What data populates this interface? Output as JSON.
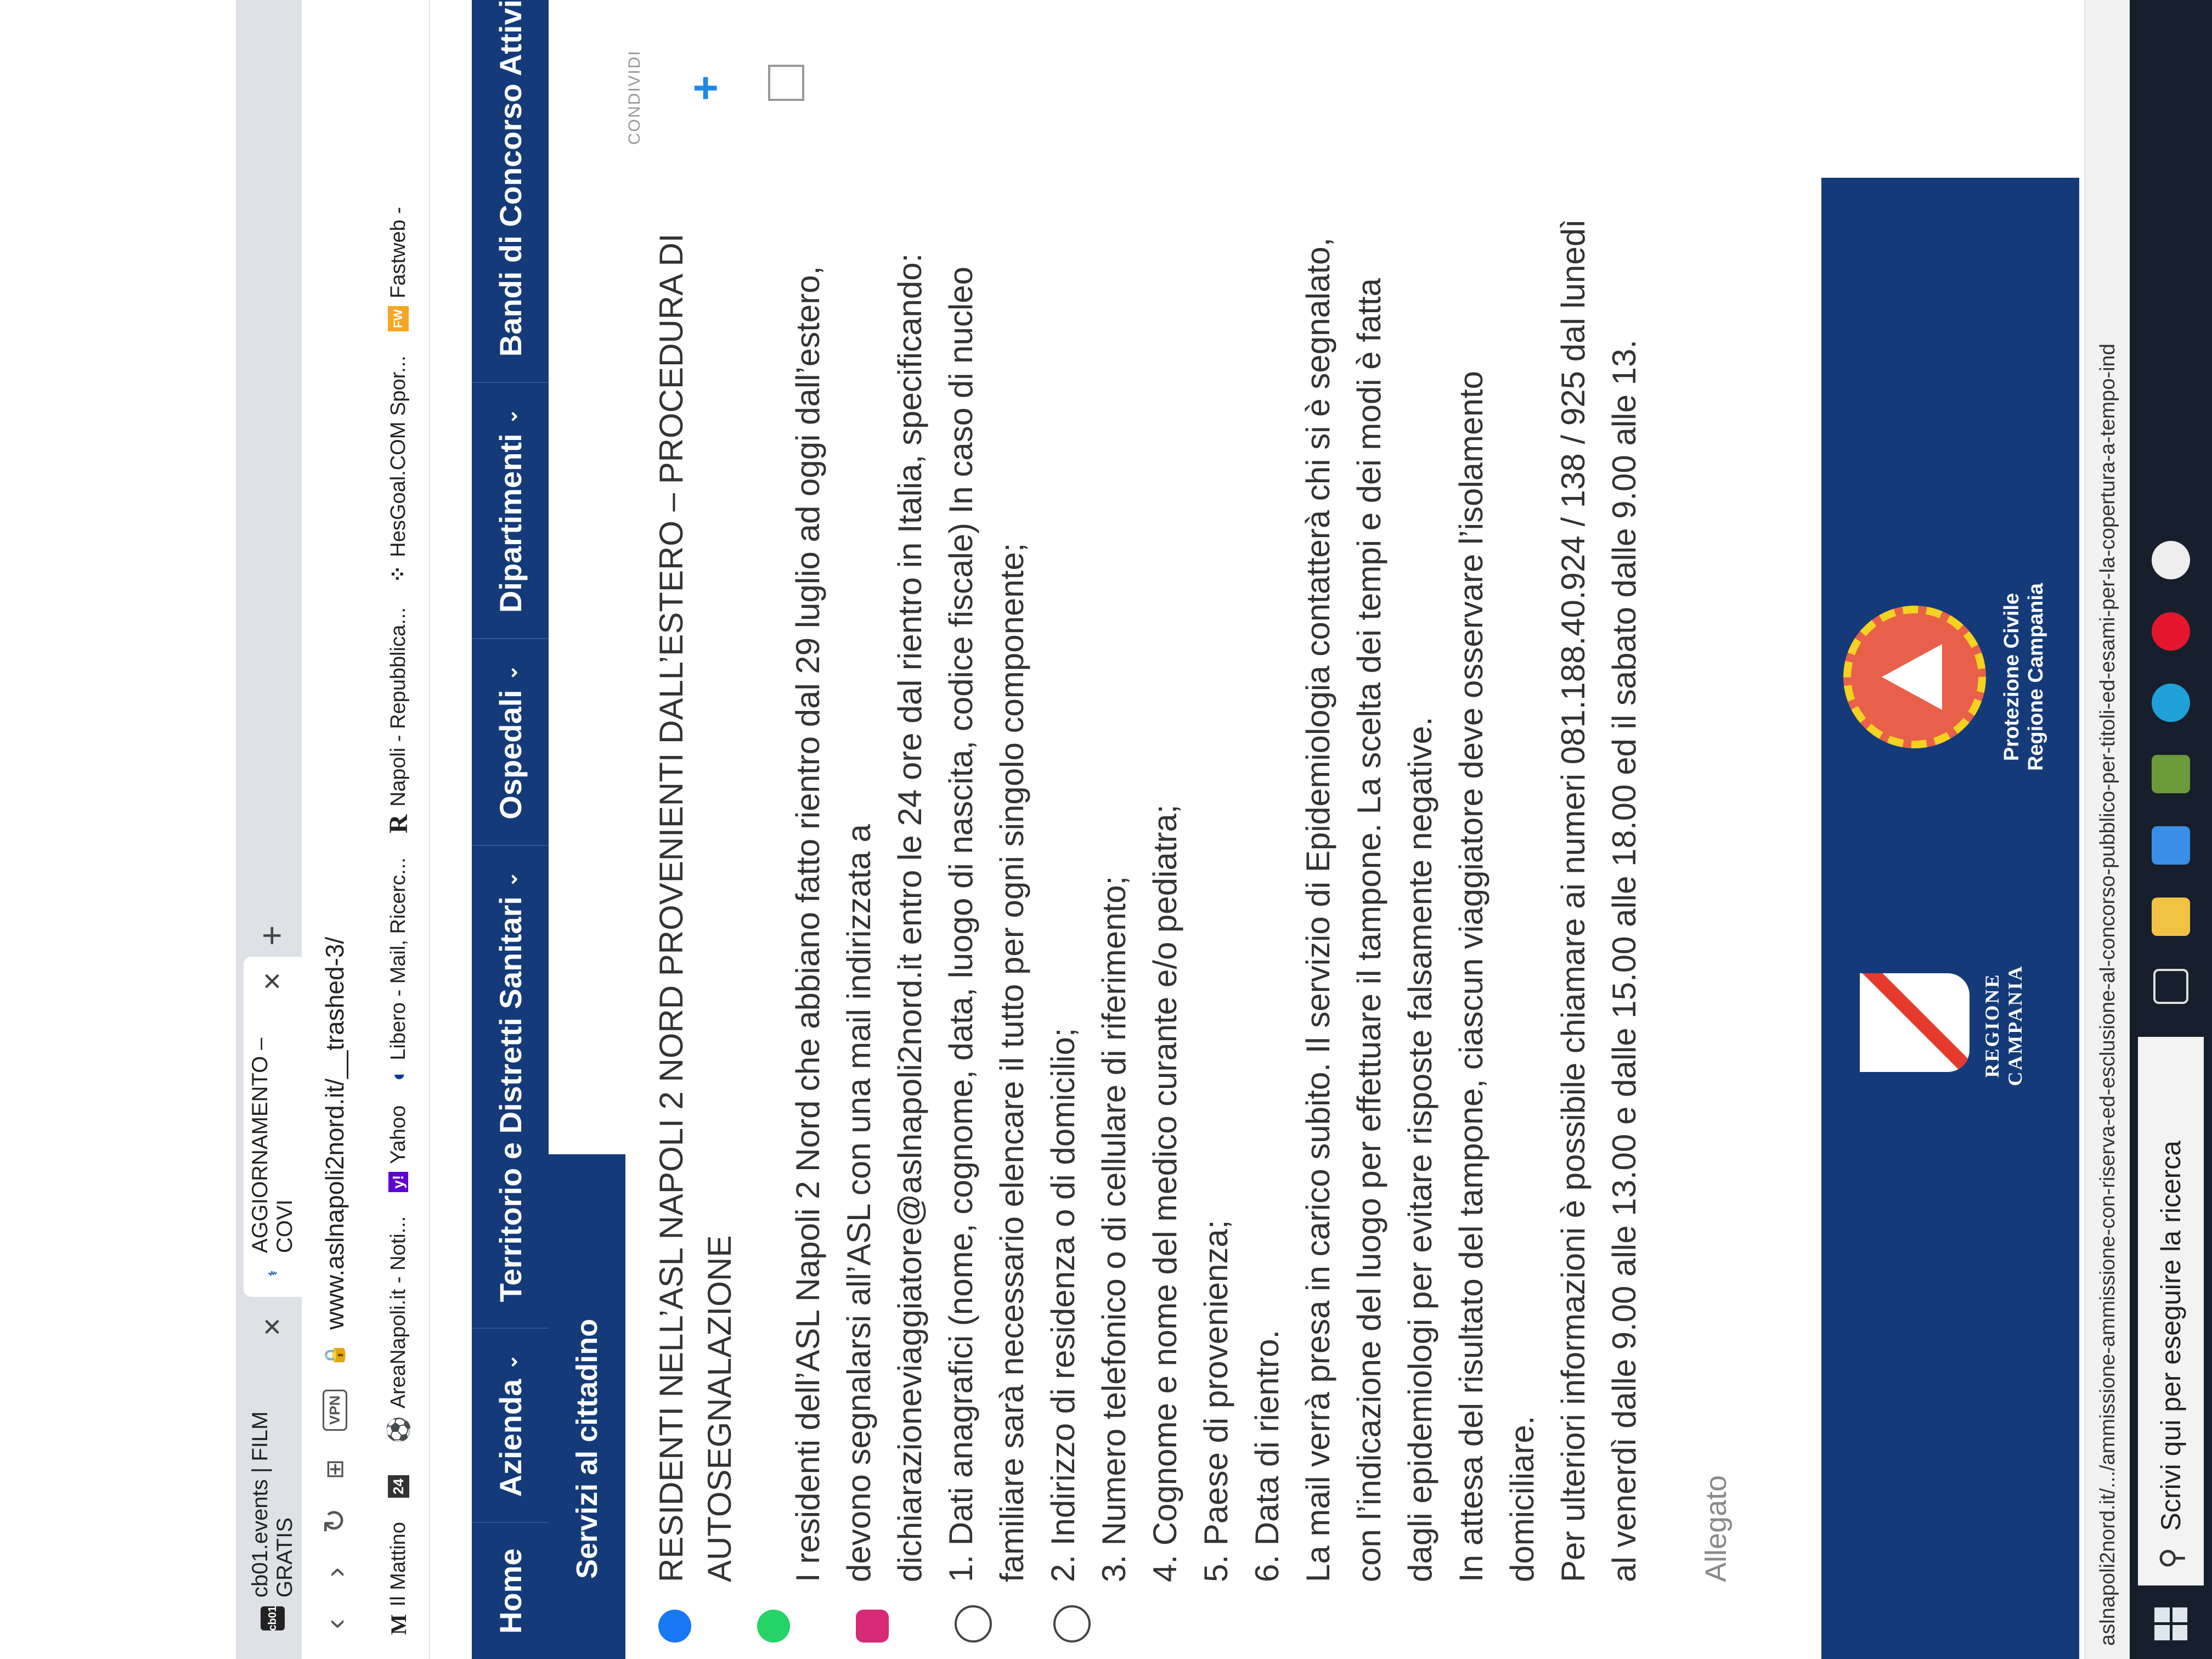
{
  "browser": {
    "tabs": [
      {
        "favicon": "cb01",
        "title": "cb01.events | FILM GRATIS"
      },
      {
        "favicon": "asl-icon",
        "title": "AGGIORNAMENTO – COVI"
      }
    ],
    "new_tab": "+",
    "vpn": "VPN",
    "url": "www.aslnapoli2nord.it/__trashed-3/",
    "bookmarks": [
      {
        "icon": "M",
        "label": "Il Mattino"
      },
      {
        "icon": "24",
        "label": ""
      },
      {
        "icon": "⚽",
        "label": "AreaNapoli.it - Noti..."
      },
      {
        "icon": "y!",
        "label": "Yahoo"
      },
      {
        "icon": "◐",
        "label": "Libero - Mail, Ricerc..."
      },
      {
        "icon": "R",
        "label": "Napoli - Repubblica..."
      },
      {
        "icon": "⁘",
        "label": "HesGoal.COM Spor..."
      },
      {
        "icon": "FW",
        "label": "Fastweb -"
      }
    ],
    "status_url": "aslnapoli2nord.it/.../ammissione-ammissione-con-riserva-ed-esclusione-al-concorso-pubblico-per-titoli-ed-esami-per-la-copertura-a-tempo-ind"
  },
  "site": {
    "nav": [
      "Home",
      "Azienda",
      "Territorio e Distretti Sanitari",
      "Ospedali",
      "Dipartimenti",
      "Bandi di Concorso Attivi"
    ],
    "subnav": "Servizi al cittadino",
    "share": "CONDIVIDI"
  },
  "article": {
    "title_1": "RESIDENTI NELL’ASL NAPOLI 2 NORD PROVENIENTI DALL’ESTERO – PROCEDURA DI",
    "title_2": "AUTOSEGNALAZIONE",
    "lines": [
      "I residenti dell’ASL Napoli 2 Nord che abbiano fatto rientro dal 29 luglio ad oggi dall’estero,",
      "devono segnalarsi all’ASL con una mail indirizzata a",
      "dichiarazioneviaggiatore@aslnapoli2nord.it entro le 24 ore dal rientro in Italia, specificando:",
      "1. Dati anagrafici (nome, cognome, data, luogo di nascita, codice fiscale) In caso di nucleo",
      "familiare sarà necessario elencare il tutto per ogni singolo componente;",
      "2. Indirizzo di residenza o di domicilio;",
      "3. Numero telefonico o di cellulare di riferimento;",
      "4. Cognome e nome del medico curante e/o pediatra;",
      "5. Paese di provenienza;",
      "6. Data di rientro.",
      "La mail verrà presa in carico subito. Il servizio di Epidemiologia contatterà chi si è segnalato,",
      "con l’indicazione del luogo per effettuare il tampone. La scelta dei tempi e dei modi è fatta",
      "dagli epidemiologi per evitare risposte falsamente negative.",
      "In attesa del risultato del tampone, ciascun viaggiatore deve osservare l’isolamento",
      "domiciliare.",
      "Per ulteriori informazioni è possibile chiamare ai numeri 081.188.40.924 / 138 / 925 dal lunedì",
      "al venerdì dalle 9.00 alle 13.00 e dalle 15.00 alle 18.00 ed il sabato dalle 9.00 alle 13."
    ],
    "attachment": "Allegato"
  },
  "banner": {
    "regione_logo": "REGIONE CAMPANIA",
    "protezione_line1": "Protezione Civile",
    "protezione_line2": "Regione Campania"
  },
  "taskbar": {
    "search_placeholder": "Scrivi qui per eseguire la ricerca"
  },
  "colors": {
    "nav_blue": "#143a7a",
    "plus_blue": "#1e88e5",
    "plus_navy": "#143a7a",
    "taskbar": "#161f2b"
  }
}
